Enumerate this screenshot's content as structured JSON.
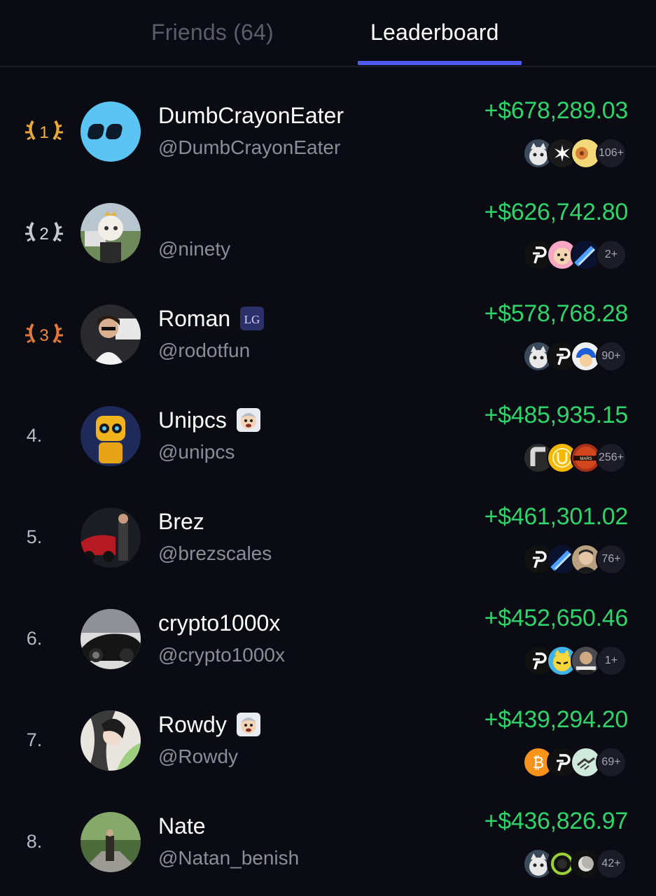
{
  "tabs": {
    "friends": "Friends (64)",
    "leaderboard": "Leaderboard"
  },
  "colors": {
    "background": "#0b0b14",
    "accent": "#4f5cf2",
    "gain": "#2fd36a",
    "gold": "#e6a93a",
    "silver": "#c9c9d2",
    "bronze": "#e07a3c"
  },
  "leaderboard": [
    {
      "rank": "1",
      "name": "DumbCrayonEater",
      "handle": "@DumbCrayonEater",
      "pnl": "+$678,289.03",
      "more": "106+",
      "tokens": [
        "cat-token-icon",
        "star-token-icon",
        "cookie-token-icon"
      ]
    },
    {
      "rank": "2",
      "name": "",
      "handle": "@ninety",
      "pnl": "+$626,742.80",
      "more": "2+",
      "tokens": [
        "pump-token-icon",
        "dog-token-icon",
        "comet-token-icon"
      ]
    },
    {
      "rank": "3",
      "name": "Roman",
      "handle": "@rodotfun",
      "pnl": "+$578,768.28",
      "more": "90+",
      "tokens": [
        "cat-token-icon",
        "pump-token-icon",
        "helmet-token-icon"
      ]
    },
    {
      "rank": "4.",
      "name": "Unipcs",
      "handle": "@unipcs",
      "pnl": "+$485,935.15",
      "more": "256+",
      "tokens": [
        "f-token-icon",
        "u-token-icon",
        "mars-token-icon"
      ]
    },
    {
      "rank": "5.",
      "name": "Brez",
      "handle": "@brezscales",
      "pnl": "+$461,301.02",
      "more": "76+",
      "tokens": [
        "pump-token-icon",
        "comet-token-icon",
        "man-token-icon"
      ]
    },
    {
      "rank": "6.",
      "name": "crypto1000x",
      "handle": "@crypto1000x",
      "pnl": "+$452,650.46",
      "more": "1+",
      "tokens": [
        "pump-token-icon",
        "cat-token-icon",
        "employee-token-icon"
      ]
    },
    {
      "rank": "7.",
      "name": "Rowdy",
      "handle": "@Rowdy",
      "pnl": "+$439,294.20",
      "more": "69+",
      "tokens": [
        "bitcoin-token-icon",
        "pump-token-icon",
        "handshake-token-icon"
      ]
    },
    {
      "rank": "8.",
      "name": "Nate",
      "handle": "@Natan_benish",
      "pnl": "+$436,826.97",
      "more": "42+",
      "tokens": [
        "cat-token-icon",
        "green-token-icon",
        "moon-token-icon"
      ]
    }
  ]
}
